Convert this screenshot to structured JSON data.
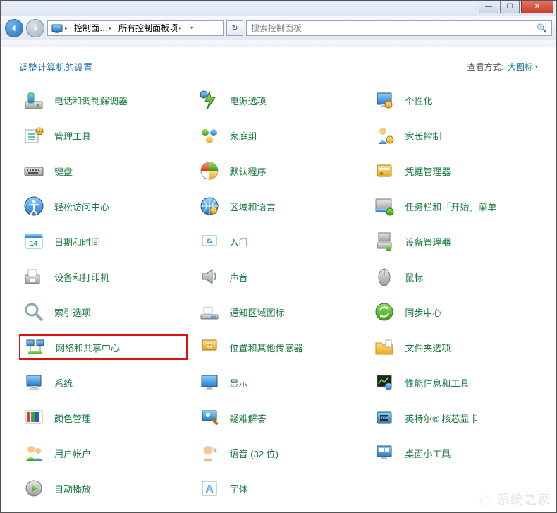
{
  "titlebar": {
    "minimize": "—",
    "maximize": "☐",
    "close": "✕"
  },
  "nav": {
    "crumb1": "控制面…",
    "crumb2": "所有控制面板项",
    "search_placeholder": "搜索控制面板"
  },
  "header": {
    "page_title": "调整计算机的设置",
    "view_by_label": "查看方式:",
    "view_by_value": "大图标"
  },
  "items": [
    {
      "label": "电话和调制解调器",
      "icon": "phone-modem"
    },
    {
      "label": "电源选项",
      "icon": "power"
    },
    {
      "label": "个性化",
      "icon": "personalize"
    },
    {
      "label": "管理工具",
      "icon": "admin-tools"
    },
    {
      "label": "家庭组",
      "icon": "homegroup"
    },
    {
      "label": "家长控制",
      "icon": "parental"
    },
    {
      "label": "键盘",
      "icon": "keyboard"
    },
    {
      "label": "默认程序",
      "icon": "default-programs"
    },
    {
      "label": "凭据管理器",
      "icon": "credentials"
    },
    {
      "label": "轻松访问中心",
      "icon": "ease-access"
    },
    {
      "label": "区域和语言",
      "icon": "region"
    },
    {
      "label": "任务栏和「开始」菜单",
      "icon": "taskbar"
    },
    {
      "label": "日期和时间",
      "icon": "datetime"
    },
    {
      "label": "入门",
      "icon": "getting-started"
    },
    {
      "label": "设备管理器",
      "icon": "device-manager"
    },
    {
      "label": "设备和打印机",
      "icon": "devices-printers"
    },
    {
      "label": "声音",
      "icon": "sound"
    },
    {
      "label": "鼠标",
      "icon": "mouse"
    },
    {
      "label": "索引选项",
      "icon": "indexing"
    },
    {
      "label": "通知区域图标",
      "icon": "notification"
    },
    {
      "label": "同步中心",
      "icon": "sync"
    },
    {
      "label": "网络和共享中心",
      "icon": "network",
      "highlight": true
    },
    {
      "label": "位置和其他传感器",
      "icon": "location"
    },
    {
      "label": "文件夹选项",
      "icon": "folder-options"
    },
    {
      "label": "系统",
      "icon": "system"
    },
    {
      "label": "显示",
      "icon": "display"
    },
    {
      "label": "性能信息和工具",
      "icon": "performance"
    },
    {
      "label": "颜色管理",
      "icon": "color"
    },
    {
      "label": "疑难解答",
      "icon": "troubleshoot"
    },
    {
      "label": "英特尔® 核芯显卡",
      "icon": "intel"
    },
    {
      "label": "用户帐户",
      "icon": "users"
    },
    {
      "label": "语音 (32 位)",
      "icon": "speech"
    },
    {
      "label": "桌面小工具",
      "icon": "gadgets"
    },
    {
      "label": "自动播放",
      "icon": "autoplay"
    },
    {
      "label": "字体",
      "icon": "fonts"
    }
  ],
  "watermark": "系统之家"
}
